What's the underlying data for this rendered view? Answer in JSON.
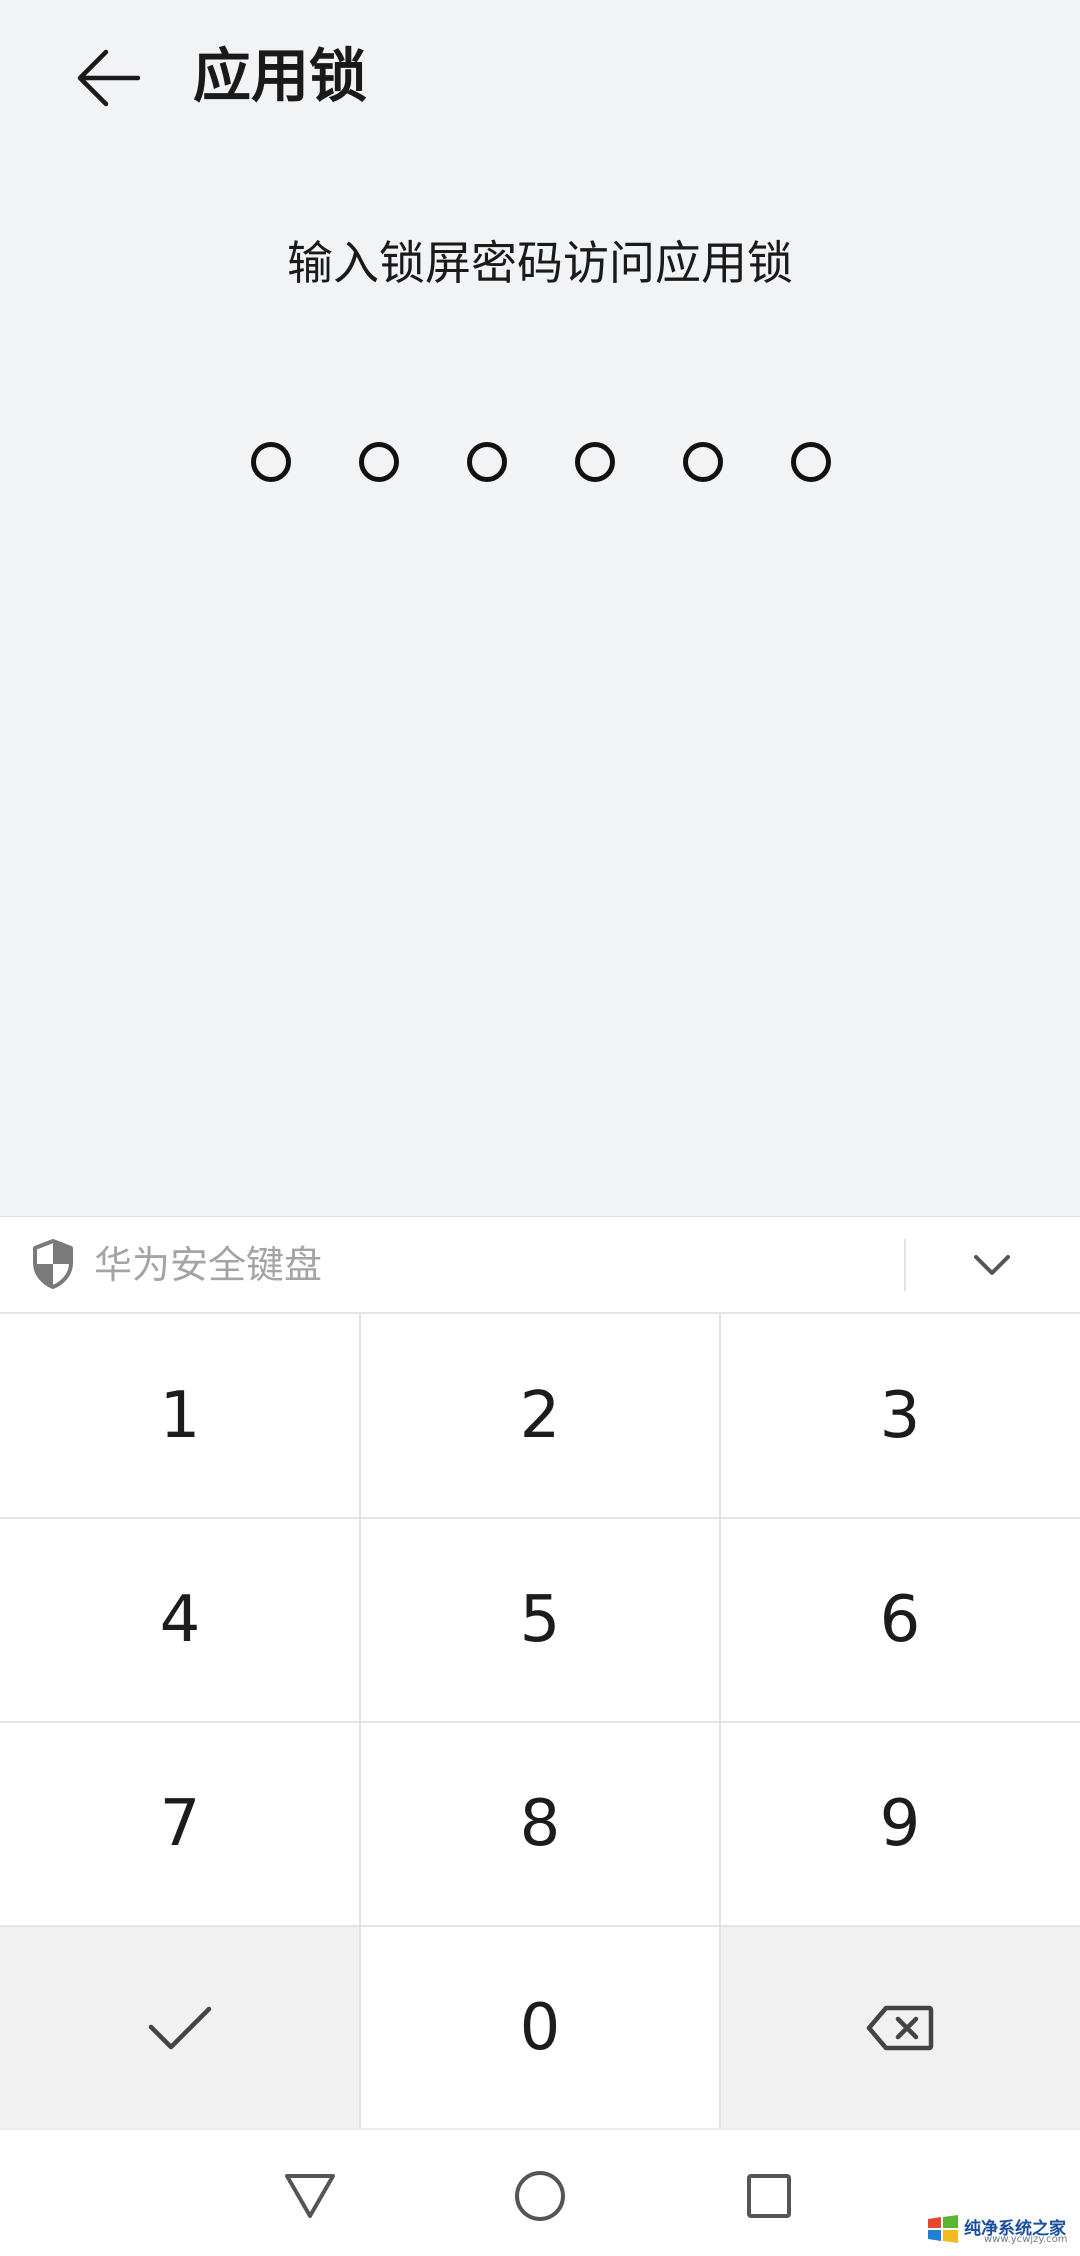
{
  "header": {
    "title": "应用锁",
    "back_icon": "arrow-left-icon"
  },
  "prompt": {
    "text": "输入锁屏密码访问应用锁"
  },
  "pin": {
    "length": 6,
    "entered": 0
  },
  "keyboard": {
    "title": "华为安全键盘",
    "shield_icon": "shield-icon",
    "collapse_icon": "chevron-down-icon",
    "keys": [
      "1",
      "2",
      "3",
      "4",
      "5",
      "6",
      "7",
      "8",
      "9"
    ],
    "zero": "0",
    "confirm_icon": "check-icon",
    "delete_icon": "backspace-icon"
  },
  "navbar": {
    "back_icon": "triangle-back-icon",
    "home_icon": "circle-home-icon",
    "recents_icon": "square-recents-icon"
  },
  "watermark": {
    "text": "纯净系统之家",
    "sub": "www.ycwjzy.com"
  },
  "colors": {
    "background": "#f2f3f5",
    "keyboard": "#ffffff",
    "function_key": "#f1f1f1",
    "hint_text": "#a4a4a4"
  }
}
